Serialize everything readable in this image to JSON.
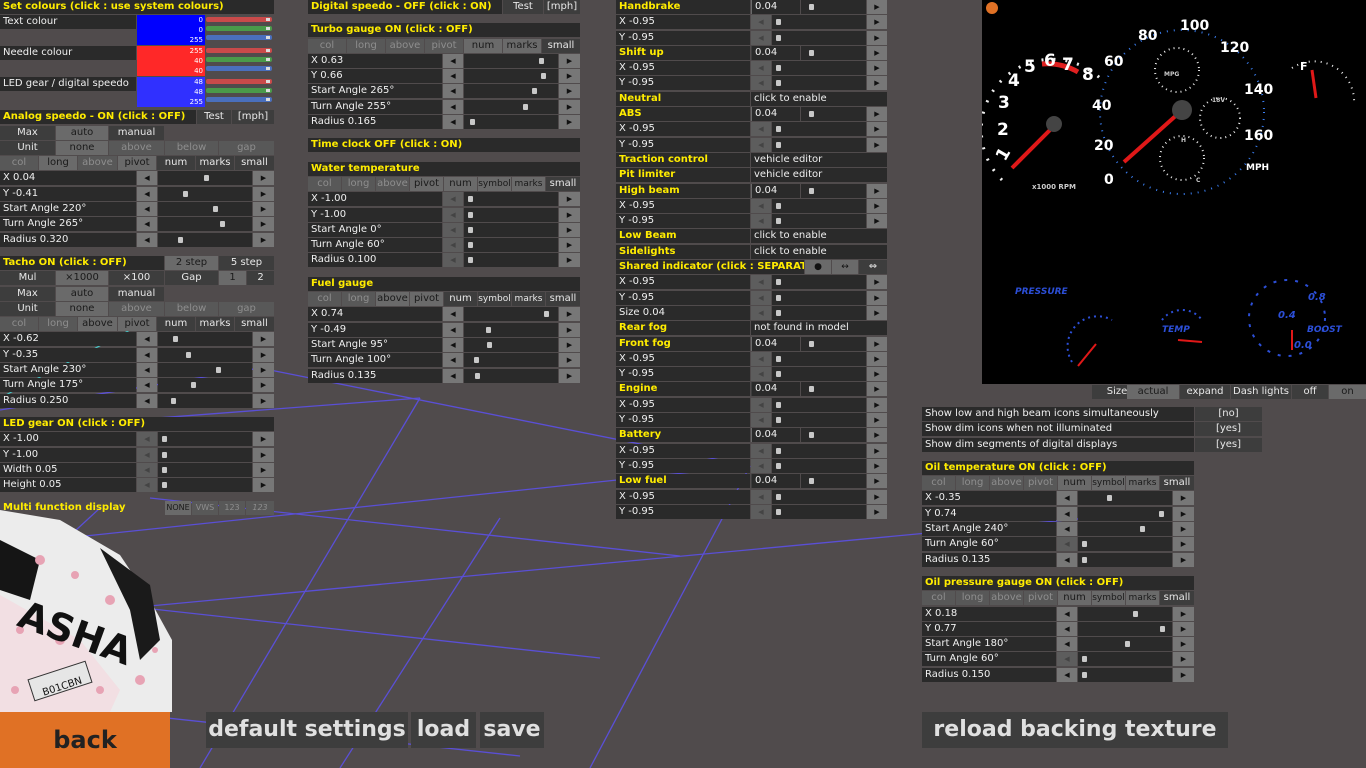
{
  "colors": {
    "bg": "#504b4c",
    "panel": "#2a2a2a",
    "header": "#ffec00",
    "button": "#6a6a6a",
    "accent_orange": "#e07125",
    "swatch_text": "#0000ff",
    "swatch_needle": "#ff2828",
    "swatch_led": "#3030ff"
  },
  "icons": {
    "light": "headlight-icon",
    "abs": "abs-icon",
    "shift": "shift-icon",
    "engine": "engine-icon",
    "battery": "battery-icon",
    "fuel": "fuel-pump-icon",
    "arrows": "left-right-arrow-icon"
  },
  "col1": {
    "set_colours": "Set colours (click : use system colours)",
    "text_colour": "Text colour",
    "text_rgb": [
      "0",
      "0",
      "255"
    ],
    "needle_colour": "Needle colour",
    "needle_rgb": [
      "255",
      "40",
      "40"
    ],
    "led_colour": "LED gear / digital speedo",
    "led_rgb": [
      "48",
      "48",
      "255"
    ],
    "analog_title": "Analog speedo - ON (click : OFF)",
    "test": "Test",
    "unit": "[mph]",
    "max": "Max",
    "auto": "auto",
    "manual": "manual",
    "unit_lbl": "Unit",
    "none": "none",
    "above": "above",
    "below": "below",
    "gap": "gap",
    "col": "col",
    "long": "long",
    "pivot": "pivot",
    "num": "num",
    "marks": "marks",
    "small": "small",
    "an_x": "X 0.04",
    "an_y": "Y -0.41",
    "an_sa": "Start Angle 220°",
    "an_ta": "Turn Angle 265°",
    "an_r": "Radius 0.320",
    "tacho_title": "Tacho ON (click : OFF)",
    "two_step": "2 step",
    "five_step": "5 step",
    "mul": "Mul",
    "x1000": "×1000",
    "x100": "×100",
    "gap_lbl": "Gap",
    "g1": "1",
    "g2": "2",
    "ta_x": "X -0.62",
    "ta_y": "Y -0.35",
    "ta_sa": "Start Angle 230°",
    "ta_ta": "Turn Angle 175°",
    "ta_r": "Radius 0.250",
    "led_title": "LED gear ON (click : OFF)",
    "led_x": "X -1.00",
    "led_y": "Y -1.00",
    "led_w": "Width 0.05",
    "led_h": "Height 0.05",
    "mfd": "Multi function display",
    "mfd_opts": [
      "NONE",
      "VWS",
      "123",
      "123"
    ]
  },
  "col2": {
    "digital_title": "Digital speedo - OFF (click : ON)",
    "test": "Test",
    "unit": "[mph]",
    "turbo_title": "Turbo gauge ON (click : OFF)",
    "col": "col",
    "long": "long",
    "above": "above",
    "pivot": "pivot",
    "num": "num",
    "marks": "marks",
    "small": "small",
    "symbol": "symbol",
    "tu_x": "X 0.63",
    "tu_y": "Y 0.66",
    "tu_sa": "Start Angle 265°",
    "tu_ta": "Turn Angle 255°",
    "tu_r": "Radius 0.165",
    "clock_title": "Time clock OFF (click : ON)",
    "water_title": "Water temperature",
    "wa_x": "X -1.00",
    "wa_y": "Y -1.00",
    "wa_sa": "Start Angle 0°",
    "wa_ta": "Turn Angle 60°",
    "wa_r": "Radius 0.100",
    "fuel_title": "Fuel gauge",
    "fu_x": "X 0.74",
    "fu_y": "Y -0.49",
    "fu_sa": "Start Angle 95°",
    "fu_ta": "Turn Angle 100°",
    "fu_r": "Radius 0.135"
  },
  "col3": {
    "x95": "X -0.95",
    "y95": "Y -0.95",
    "val": "0.04",
    "off": "off",
    "handbrake": "Handbrake",
    "shift_up": "Shift up",
    "neutral": "Neutral",
    "click_enable": "click to enable",
    "abs": "ABS",
    "traction": "Traction control",
    "vehicle_editor": "vehicle editor",
    "pit": "Pit limiter",
    "high_beam": "High beam",
    "low_beam": "Low Beam",
    "sidelights": "Sidelights",
    "shared": "Shared indicator (click : SEPARATE)",
    "size": "Size 0.04",
    "rear_fog": "Rear fog",
    "not_found": "not found in model",
    "front_fog": "Front fog",
    "engine": "Engine",
    "battery": "Battery",
    "low_fuel": "Low fuel",
    "abs_icon": "ABS",
    "shift_icon": "SHIFT"
  },
  "col4": {
    "size": "Size",
    "actual": "actual",
    "expand": "expand",
    "dash_lights": "Dash lights",
    "off": "off",
    "on": "on",
    "opt1": "Show low and high beam icons simultaneously",
    "opt1v": "[no]",
    "opt2": "Show dim icons when not illuminated",
    "opt2v": "[yes]",
    "opt3": "Show dim segments of digital displays",
    "opt3v": "[yes]",
    "oil_t_title": "Oil temperature ON (click : OFF)",
    "col": "col",
    "long": "long",
    "above": "above",
    "pivot": "pivot",
    "num": "num",
    "symbol": "symbol",
    "marks": "marks",
    "small": "small",
    "ot_x": "X -0.35",
    "ot_y": "Y 0.74",
    "ot_sa": "Start Angle 240°",
    "ot_ta": "Turn Angle 60°",
    "ot_r": "Radius 0.135",
    "oil_p_title": "Oil pressure gauge ON (click : OFF)",
    "op_x": "X 0.18",
    "op_y": "Y 0.77",
    "op_sa": "Start Angle 180°",
    "op_ta": "Turn Angle 60°",
    "op_r": "Radius 0.150"
  },
  "dash": {
    "tacho_nums": [
      "1",
      "2",
      "3",
      "4",
      "5",
      "6",
      "7",
      "8"
    ],
    "tacho_unit": "x1000 RPM",
    "speed_nums": [
      "0",
      "20",
      "40",
      "60",
      "80",
      "100",
      "120",
      "140",
      "160"
    ],
    "speed_unit": "MPH",
    "mpg": "MPG",
    "volts": "18V",
    "fuel_f": "F",
    "temp_h": "H",
    "temp_c": "C",
    "pressure": "PRESSURE",
    "temp": "TEMP",
    "boost": "BOOST",
    "b1": "0.4",
    "b2": "0.8",
    "b3": "0.0"
  },
  "car_text": "ASHA",
  "plate": "B01CBN",
  "bottom": {
    "back": "back",
    "default": "default settings",
    "load": "load",
    "save": "save",
    "reload": "reload backing texture"
  }
}
